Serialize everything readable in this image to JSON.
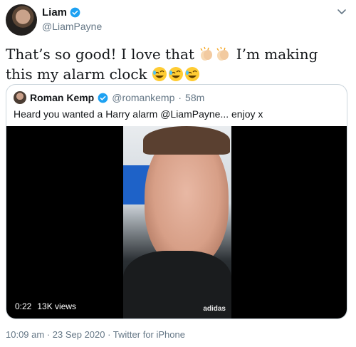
{
  "author": {
    "name": "Liam",
    "handle": "@LiamPayne"
  },
  "tweet": {
    "text_part1": "That’s so good! I love that",
    "text_part2": "I’m making this my alarm clock",
    "emojis_mid": [
      "clapping-hands-emoji",
      "clapping-hands-emoji"
    ],
    "emojis_end": [
      "rofl-emoji",
      "rofl-emoji",
      "rofl-emoji"
    ]
  },
  "quote": {
    "name": "Roman Kemp",
    "handle": "@romankemp",
    "separator": "·",
    "time": "58m",
    "text": "Heard you wanted a Harry alarm @LiamPayne... enjoy x",
    "video": {
      "duration": "0:22",
      "views": "13K views",
      "brand": "adidas"
    }
  },
  "footer": {
    "meta": "10:09 am · 23 Sep 2020 · Twitter for iPhone"
  },
  "colors": {
    "verified": "#1da1f2",
    "secondary_text": "#657786",
    "border": "#ccd6dd"
  }
}
